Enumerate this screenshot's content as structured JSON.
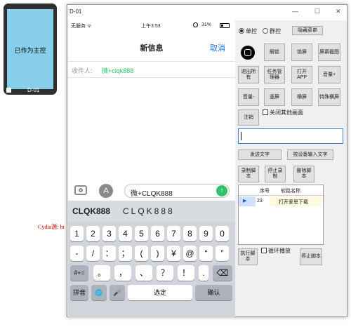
{
  "device_tile": {
    "status": "已作为主控",
    "name": "D-01"
  },
  "note": "Cydia源: ht",
  "window": {
    "title": "D-01"
  },
  "phone": {
    "status_bar": {
      "carrier": "无服务",
      "time": "上午3:53",
      "battery": "31%"
    },
    "nav": {
      "title": "新信息",
      "cancel": "取消"
    },
    "recipient": {
      "label": "收件人:",
      "value": "微+clqk888"
    },
    "message": {
      "text": "微+CLQK888",
      "send_icon": "arrow-up-icon"
    },
    "candidates": [
      "CLQK888",
      "CLQK888"
    ],
    "keyboard": {
      "row1": [
        "1",
        "2",
        "3",
        "4",
        "5",
        "6",
        "7",
        "8",
        "9",
        "0"
      ],
      "row2": [
        "-",
        "/",
        "：",
        "；",
        "(",
        ")",
        "¥",
        "@",
        "“",
        "”"
      ],
      "row3": [
        "#+=",
        "。",
        "，",
        "、",
        "？",
        "！",
        "."
      ],
      "row4": [
        "拼音",
        "选定",
        "确认"
      ],
      "icons": {
        "backspace": "⌫",
        "globe": "🌐",
        "mic": "🎤",
        "camera": "camera-icon",
        "appstore": "appstore-icon"
      }
    }
  },
  "panel": {
    "mode": {
      "single": "单控",
      "group": "群控",
      "selected": "single"
    },
    "hide_menu": "隐藏菜单",
    "row_a": [
      "解锁",
      "锁屏",
      "屏幕截图"
    ],
    "row_b": [
      "退出所有",
      "任务管理器",
      "打开APP",
      "音量+"
    ],
    "row_c": [
      "音量-",
      "竖屏",
      "横屏",
      "特殊横屏"
    ],
    "logout": "注销",
    "close_others": "关闭其他画面",
    "send_text": "发送文字",
    "device_input": "按设备输入文字",
    "record": "录制脚本",
    "stop_record": "停止录制",
    "delete_script": "删除脚本",
    "script_table": {
      "columns": [
        "序号",
        "软路名称"
      ],
      "rows": [
        {
          "index": "23",
          "name": "打开爱思下载"
        }
      ]
    },
    "run_script": "执行脚本",
    "loop_play": "循环播放",
    "stop_script": "停止脚本"
  }
}
